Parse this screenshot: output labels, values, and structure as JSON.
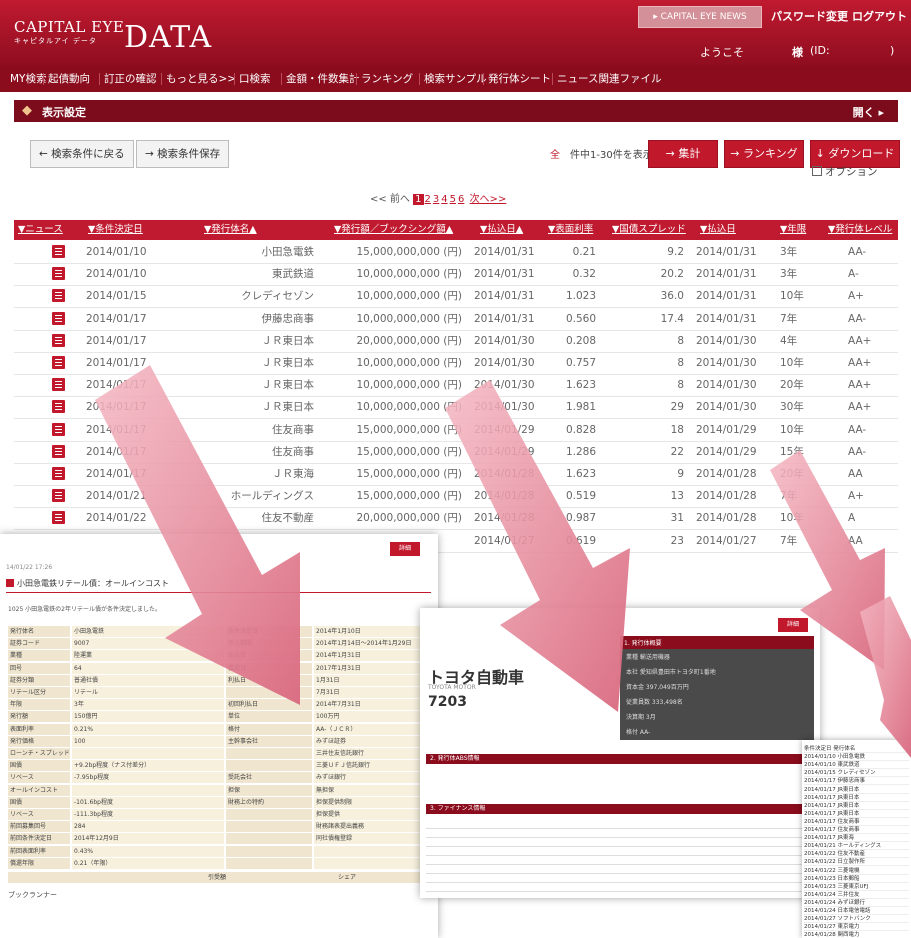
{
  "header": {
    "logo_en": "CAPITAL EYE",
    "logo_kana": "キャピタルアイ データ",
    "logo_data": "DATA",
    "news_button": "▸ CAPITAL EYE NEWS",
    "password_change": "パスワード変更",
    "logout": "ログアウト",
    "welcome": "ようこそ",
    "sama": "様",
    "id_label": "(ID:",
    "id_close": ")"
  },
  "nav": {
    "items": [
      "MY検索",
      "起債動向",
      "訂正の確認",
      "もっと見る>>",
      "口検索",
      "金額・件数集計",
      "ランキング",
      "検索サンプル",
      "発行体シート",
      "ニュース関連ファイル"
    ]
  },
  "settings": {
    "title": "表示設定",
    "open": "開く ▸"
  },
  "toolbar": {
    "back_label": "← 検索条件に戻る",
    "save_label": "→ 検索条件保存",
    "per_page": "件中1-30件を表示",
    "total_dot": "全",
    "aggregate": "→ 集計",
    "ranking": "→ ランキング",
    "download": "↓ ダウンロード",
    "option": "オプション"
  },
  "pager": {
    "prev": "<< 前へ",
    "current": "1",
    "pages": [
      "2",
      "3",
      "4",
      "5",
      "6"
    ],
    "next": "次へ>>"
  },
  "table": {
    "headers": [
      "▼ニュース",
      "▼条件決定日",
      "▼発行体名▲",
      "▼発行額／ブックシング額▲",
      "▼払込日▲",
      "▼表面利率",
      "▼国債スプレッド",
      "▼払込日",
      "▼年限",
      "▼発行体レベル"
    ],
    "rows": [
      {
        "date": "2014/01/10",
        "issuer": "小田急電鉄",
        "amount": "15,000,000,000 (円)",
        "pay": "2014/01/31",
        "rate": "0.21",
        "spread": "9.2",
        "pay2": "2014/01/31",
        "term": "3年",
        "rating": "AA-"
      },
      {
        "date": "2014/01/10",
        "issuer": "東武鉄道",
        "amount": "10,000,000,000 (円)",
        "pay": "2014/01/31",
        "rate": "0.32",
        "spread": "20.2",
        "pay2": "2014/01/31",
        "term": "3年",
        "rating": "A-"
      },
      {
        "date": "2014/01/15",
        "issuer": "クレディセゾン",
        "amount": "10,000,000,000 (円)",
        "pay": "2014/01/31",
        "rate": "1.023",
        "spread": "36.0",
        "pay2": "2014/01/31",
        "term": "10年",
        "rating": "A+"
      },
      {
        "date": "2014/01/17",
        "issuer": "伊藤忠商事",
        "amount": "10,000,000,000 (円)",
        "pay": "2014/01/31",
        "rate": "0.560",
        "spread": "17.4",
        "pay2": "2014/01/31",
        "term": "7年",
        "rating": "AA-"
      },
      {
        "date": "2014/01/17",
        "issuer": "ＪＲ東日本",
        "amount": "20,000,000,000 (円)",
        "pay": "2014/01/30",
        "rate": "0.208",
        "spread": "8",
        "pay2": "2014/01/30",
        "term": "4年",
        "rating": "AA+"
      },
      {
        "date": "2014/01/17",
        "issuer": "ＪＲ東日本",
        "amount": "10,000,000,000 (円)",
        "pay": "2014/01/30",
        "rate": "0.757",
        "spread": "8",
        "pay2": "2014/01/30",
        "term": "10年",
        "rating": "AA+"
      },
      {
        "date": "2014/01/17",
        "issuer": "ＪＲ東日本",
        "amount": "10,000,000,000 (円)",
        "pay": "2014/01/30",
        "rate": "1.623",
        "spread": "8",
        "pay2": "2014/01/30",
        "term": "20年",
        "rating": "AA+"
      },
      {
        "date": "2014/01/17",
        "issuer": "ＪＲ東日本",
        "amount": "10,000,000,000 (円)",
        "pay": "2014/01/30",
        "rate": "1.981",
        "spread": "29",
        "pay2": "2014/01/30",
        "term": "30年",
        "rating": "AA+"
      },
      {
        "date": "2014/01/17",
        "issuer": "住友商事",
        "amount": "15,000,000,000 (円)",
        "pay": "2014/01/29",
        "rate": "0.828",
        "spread": "18",
        "pay2": "2014/01/29",
        "term": "10年",
        "rating": "AA-"
      },
      {
        "date": "2014/01/17",
        "issuer": "住友商事",
        "amount": "15,000,000,000 (円)",
        "pay": "2014/01/29",
        "rate": "1.286",
        "spread": "22",
        "pay2": "2014/01/29",
        "term": "15年",
        "rating": "AA-"
      },
      {
        "date": "2014/01/17",
        "issuer": "ＪＲ東海",
        "amount": "15,000,000,000 (円)",
        "pay": "2014/01/28",
        "rate": "1.623",
        "spread": "9",
        "pay2": "2014/01/28",
        "term": "20年",
        "rating": "AA"
      },
      {
        "date": "2014/01/21",
        "issuer": "ホールディングス",
        "amount": "15,000,000,000 (円)",
        "pay": "2014/01/28",
        "rate": "0.519",
        "spread": "13",
        "pay2": "2014/01/28",
        "term": "7年",
        "rating": "A+"
      },
      {
        "date": "2014/01/22",
        "issuer": "住友不動産",
        "amount": "20,000,000,000 (円)",
        "pay": "2014/01/28",
        "rate": "0.987",
        "spread": "31",
        "pay2": "2014/01/28",
        "term": "10年",
        "rating": "A"
      },
      {
        "date": "2014/01/22",
        "issuer": "",
        "amount": "",
        "pay": "2014/01/27",
        "rate": "0.619",
        "spread": "23",
        "pay2": "2014/01/27",
        "term": "7年",
        "rating": "AA"
      }
    ]
  },
  "shot1": {
    "button": "詳細",
    "date": "14/01/22 17:26",
    "title": "小田急電鉄リテール債：オールインコスト",
    "sub": "1025 小田急電鉄の2年リテール債が条件決定しました。",
    "rows": [
      [
        "発行体名",
        "小田急電鉄",
        "条件決定日",
        "2014年1月10日"
      ],
      [
        "証券コード",
        "9007",
        "申込期間",
        "2014年1月14日～2014年1月29日"
      ],
      [
        "業種",
        "陸運業",
        "払込日",
        "2014年1月31日"
      ],
      [
        "回号",
        "64",
        "償還日",
        "2017年1月31日"
      ],
      [
        "証券分類",
        "普通社債",
        "利払日",
        "1月31日"
      ],
      [
        "リテール区分",
        "リテール",
        "",
        "7月31日"
      ],
      [
        "年限",
        "3年",
        "初回利払日",
        "2014年7月31日"
      ],
      [
        "発行額",
        "150億円",
        "単位",
        "100万円"
      ],
      [
        "表面利率",
        "0.21%",
        "格付",
        "AA-（ＪＣＲ）"
      ],
      [
        "発行価格",
        "100",
        "主幹事会社",
        "みずほ証券"
      ],
      [
        "ローンチ・スプレッド",
        "",
        "",
        "三井住友信託銀行"
      ],
      [
        "国債",
        "+9.2bp程度（ナス付差分）",
        "",
        "三菱ＵＦＪ信託銀行"
      ],
      [
        "リベース",
        "-7.95bp程度",
        "受託会社",
        "みずほ銀行"
      ],
      [
        "オールインコスト",
        "",
        "担保",
        "無担保"
      ],
      [
        "国債",
        "-101.6bp程度",
        "財務上の特約",
        "担保提供制限"
      ],
      [
        "リベース",
        "-111.3bp程度",
        "",
        "担保提供"
      ],
      [
        "前回募集回号",
        "284",
        "",
        "財務諸表提出義務"
      ],
      [
        "前回条件決定日",
        "2014年12月9日",
        "",
        "同社債権登録"
      ],
      [
        "前回表面利率",
        "0.43%",
        "",
        ""
      ],
      [
        "償還年限",
        "0.21（年限）",
        "",
        ""
      ]
    ],
    "footer_a": "引受額",
    "footer_b": "シェア",
    "bookrunner": "ブックランナー"
  },
  "shot2": {
    "button": "詳細",
    "name": "トヨタ自動車",
    "en": "TOYOTA MOTOR",
    "code": "7203",
    "panel_title": "1. 発行体概要",
    "panel_rows": [
      "業種  輸送用機器",
      "本社  愛知県豊田市トヨタ町1番地",
      "資本金 397,049百万円",
      "従業員数 333,498名",
      "決算期 3月",
      "格付  AA-"
    ],
    "sec1": "2. 発行体ABS情報",
    "sec2": "3. ファイナンス情報"
  },
  "shot3": {
    "rows": [
      "条件決定日  発行体名",
      "2014/01/10 小田急電鉄",
      "2014/01/10 東武鉄道",
      "2014/01/15 クレディセゾン",
      "2014/01/17 伊藤忠商事",
      "2014/01/17 JR東日本",
      "2014/01/17 JR東日本",
      "2014/01/17 JR東日本",
      "2014/01/17 JR東日本",
      "2014/01/17 住友商事",
      "2014/01/17 住友商事",
      "2014/01/17 JR東海",
      "2014/01/21 ホールディングス",
      "2014/01/22 住友不動産",
      "2014/01/22 日立製作所",
      "2014/01/22 三菱電機",
      "2014/01/23 日本郵船",
      "2014/01/23 三菱東京UFJ",
      "2014/01/24 三井住友",
      "2014/01/24 みずほ銀行",
      "2014/01/24 日本電信電話",
      "2014/01/27 ソフトバンク",
      "2014/01/27 東京電力",
      "2014/01/28 関西電力"
    ]
  },
  "colors": {
    "brand": "#c1182c",
    "dark": "#8a0c1d",
    "arrow": "#e48a9a"
  }
}
